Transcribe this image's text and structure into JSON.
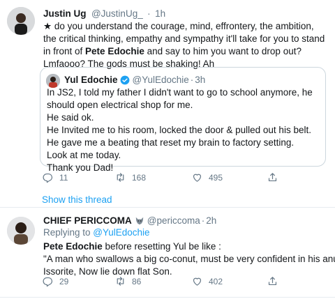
{
  "tweet1": {
    "author_name": "Justin Ug",
    "author_handle": "@JustinUg_",
    "dot": "·",
    "time": "1h",
    "text_part1": "★ do you understand the courage, mind, effrontery, the ambition, the critical thinking, empathy and sympathy it'll take for you to stand  in front of ",
    "text_bold1": "Pete Edochie",
    "text_part2": " and say to him you want to drop out? Lmfaooo? The gods must be shaking! Ah",
    "quote": {
      "author_name": "Yul Edochie",
      "author_handle": "@YulEdochie",
      "dot": "·",
      "time": "3h",
      "lines": [
        "In JS2, I told my father I didn't want to go to school anymore, he should open electrical shop for me.",
        "He said ok.",
        "He Invited me to his room, locked the door & pulled out his belt.",
        "He gave me a beating that reset my brain to factory setting.",
        "Look at me today.",
        "Thank you Dad!"
      ]
    },
    "replies": "11",
    "retweets": "168",
    "likes": "495",
    "show_thread": "Show this thread"
  },
  "tweet2": {
    "author_name": "CHIEF PERICCOMA",
    "author_handle": "@periccoma",
    "dot": "·",
    "time": "2h",
    "replying_prefix": "Replying to ",
    "replying_handle": "@YulEdochie",
    "text_bold": "Pete Edochie",
    "text_rest": " before resetting Yul be like :",
    "line2": "\"A man who swallows a big co-conut, must be very confident in his anus\"",
    "line3": "Issorite, Now lie down flat Son.",
    "replies": "29",
    "retweets": "86",
    "likes": "402"
  },
  "colors": {
    "accent": "#1da1f2",
    "muted": "#657786",
    "border": "#ccd6dd"
  },
  "icons": [
    "verified-badge-icon",
    "reply-icon",
    "retweet-icon",
    "like-icon",
    "share-icon",
    "wolf-emoji-icon"
  ]
}
